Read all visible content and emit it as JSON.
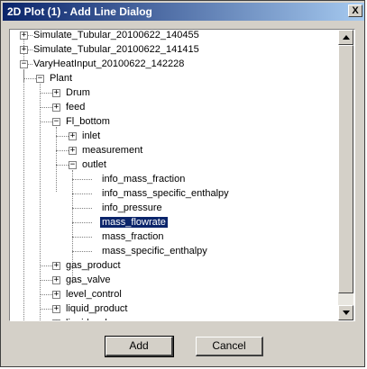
{
  "window": {
    "title": "2D Plot (1) - Add Line Dialog",
    "close_glyph": "X"
  },
  "tree": {
    "rows": [
      {
        "label": "Simulate_Tubular_20100622_140455",
        "expander": "+"
      },
      {
        "label": "Simulate_Tubular_20100622_141415",
        "expander": "+"
      },
      {
        "label": "VaryHeatInput_20100622_142228",
        "expander": "−"
      },
      {
        "label": "Plant",
        "expander": "−"
      },
      {
        "label": "Drum",
        "expander": "+"
      },
      {
        "label": "feed",
        "expander": "+"
      },
      {
        "label": "Fl_bottom",
        "expander": "−"
      },
      {
        "label": "inlet",
        "expander": "+"
      },
      {
        "label": "measurement",
        "expander": "+"
      },
      {
        "label": "outlet",
        "expander": "−"
      },
      {
        "label": "info_mass_fraction"
      },
      {
        "label": "info_mass_specific_enthalpy"
      },
      {
        "label": "info_pressure"
      },
      {
        "label": "mass_flowrate",
        "selected": true
      },
      {
        "label": "mass_fraction"
      },
      {
        "label": "mass_specific_enthalpy"
      },
      {
        "label": "gas_product",
        "expander": "+"
      },
      {
        "label": "gas_valve",
        "expander": "+"
      },
      {
        "label": "level_control",
        "expander": "+"
      },
      {
        "label": "liquid_product",
        "expander": "+"
      },
      {
        "label": "liquid_valve",
        "expander": "+"
      }
    ]
  },
  "buttons": {
    "add": "Add",
    "cancel": "Cancel"
  },
  "colors": {
    "title_start": "#0a246a",
    "title_end": "#a6caf0",
    "selection": "#0a246a",
    "face": "#d4d0c8"
  }
}
